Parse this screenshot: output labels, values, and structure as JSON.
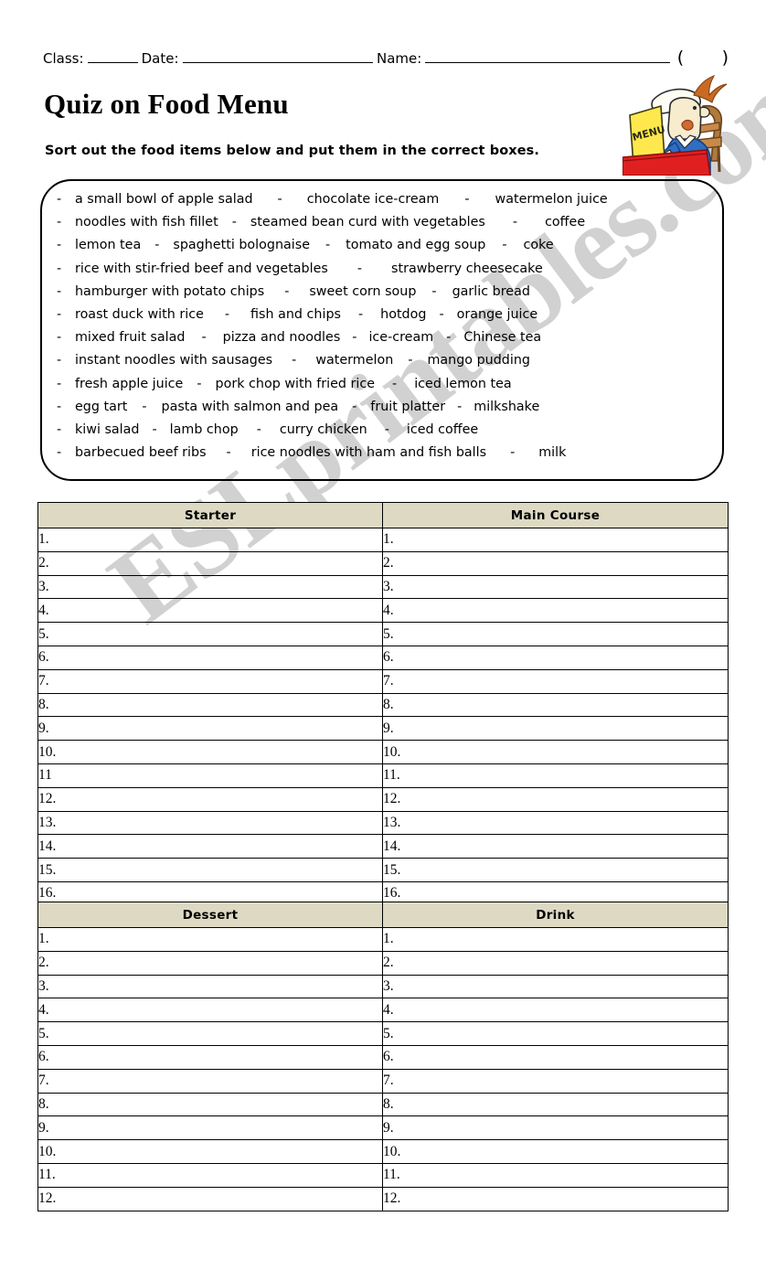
{
  "header": {
    "class_label": "Class:",
    "date_label": "Date:",
    "name_label": "Name:",
    "paren_open": "(",
    "paren_close": ")"
  },
  "title": "Quiz on Food Menu",
  "instruction": "Sort out the food items below and put them in the correct boxes.",
  "clipart": {
    "name": "man-reading-menu-at-table",
    "menu_text": "MENU",
    "colors": {
      "table": "#e02020",
      "menu_card": "#ffe84d",
      "shirt": "#2e6fc4",
      "chair": "#8a5a2b",
      "skin": "#f5e6c8"
    }
  },
  "word_bank": {
    "bullet": "-",
    "separator": "-",
    "rows": [
      [
        "a small bowl of apple salad",
        "chocolate ice-cream",
        "watermelon juice"
      ],
      [
        "noodles with fish fillet",
        "steamed bean curd with vegetables",
        "coffee"
      ],
      [
        "lemon tea",
        "spaghetti bolognaise",
        "tomato and egg soup",
        "coke"
      ],
      [
        "rice with stir-fried beef and vegetables",
        "strawberry cheesecake"
      ],
      [
        "hamburger with potato chips",
        "sweet corn soup",
        "garlic bread"
      ],
      [
        "roast duck with rice",
        "fish and chips",
        "hotdog",
        "orange juice"
      ],
      [
        "mixed fruit salad",
        "pizza and noodles",
        "ice-cream",
        "Chinese tea"
      ],
      [
        "instant noodles with sausages",
        "watermelon",
        "mango pudding"
      ],
      [
        "fresh apple juice",
        "pork chop with fried rice",
        "iced lemon tea"
      ],
      [
        "egg tart",
        "pasta with salmon and pea",
        "fruit platter",
        "milkshake"
      ],
      [
        "kiwi salad",
        "lamb chop",
        "curry chicken",
        "iced coffee"
      ],
      [
        "barbecued beef ribs",
        "rice noodles with ham and fish balls",
        "milk"
      ]
    ]
  },
  "tables": {
    "top": {
      "headers": [
        "Starter",
        "Main Course"
      ],
      "left_numbers": [
        "1.",
        "2.",
        "3.",
        "4.",
        "5.",
        "6.",
        "7.",
        "8.",
        "9.",
        "10.",
        "11",
        "12.",
        "13.",
        "14.",
        "15.",
        "16."
      ],
      "right_numbers": [
        "1.",
        "2.",
        "3.",
        "4.",
        "5.",
        "6.",
        "7.",
        "8.",
        "9.",
        "10.",
        "11.",
        "12.",
        "13.",
        "14.",
        "15.",
        "16."
      ]
    },
    "bottom": {
      "headers": [
        "Dessert",
        "Drink"
      ],
      "left_numbers": [
        "1.",
        "2.",
        "3.",
        "4.",
        "5.",
        "6.",
        "7.",
        "8.",
        "9.",
        "10.",
        "11.",
        "12."
      ],
      "right_numbers": [
        "1.",
        "2.",
        "3.",
        "4.",
        "5.",
        "6.",
        "7.",
        "8.",
        "9.",
        "10.",
        "11.",
        "12."
      ]
    }
  },
  "watermark": {
    "text": "ESLprintables.com",
    "color": "#c9c9c9"
  }
}
